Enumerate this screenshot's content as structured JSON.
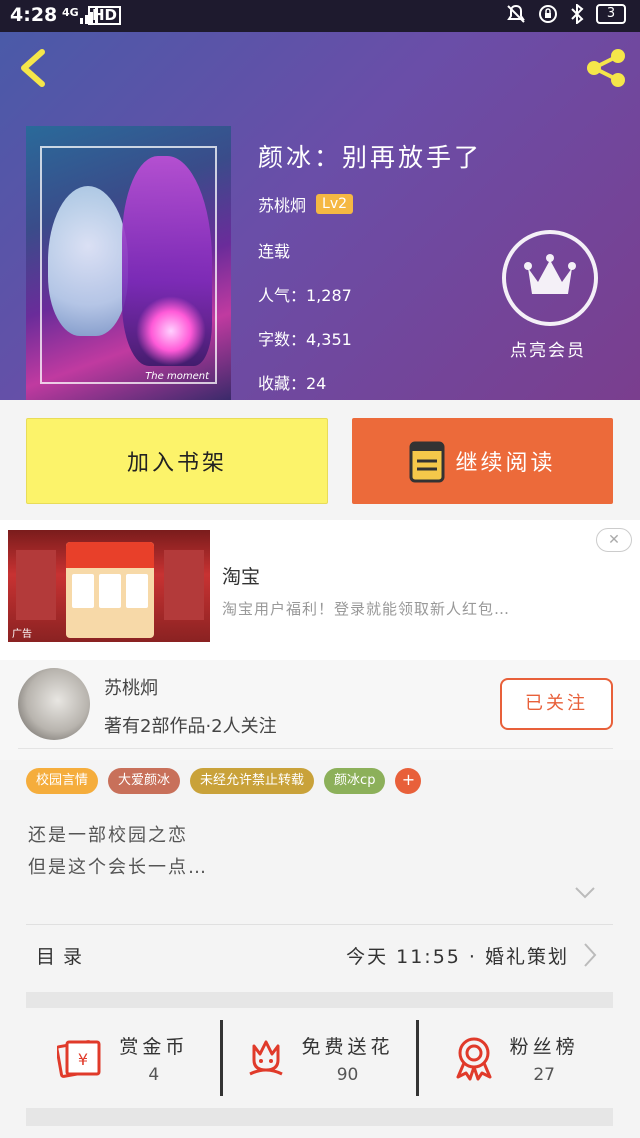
{
  "status_bar": {
    "time": "4:28",
    "network": "4G",
    "hd": "HD",
    "battery": "3"
  },
  "book": {
    "title": "颜冰：别再放手了",
    "author": "苏桃炯",
    "level": "Lv2",
    "status": "连载",
    "popularity": "人气：1,287",
    "word_count": "字数：4,351",
    "favorites": "收藏：24",
    "cover_signature": "The moment"
  },
  "vip": {
    "label": "点亮会员"
  },
  "buttons": {
    "add_to_shelf": "加入书架",
    "continue_reading": "继续阅读"
  },
  "ad": {
    "title": "淘宝",
    "description": "淘宝用户福利！登录就能领取新人红包…",
    "tag": "广告",
    "close": "✕"
  },
  "author_section": {
    "name": "苏桃炯",
    "works": "著有2部作品·2人关注",
    "follow_label": "已关注"
  },
  "tags": [
    {
      "label": "校园言情",
      "color": "#f5ad3c"
    },
    {
      "label": "大爱颜冰",
      "color": "#c8705a"
    },
    {
      "label": "未经允许禁止转载",
      "color": "#c9a23a"
    },
    {
      "label": "颜冰cp",
      "color": "#8cb05a"
    }
  ],
  "tag_add": "+",
  "description": {
    "line1": "还是一部校园之恋",
    "line2": "但是这个会长一点…"
  },
  "toc": {
    "label": "目录",
    "latest": "今天 11:55 · 婚礼策划"
  },
  "actions": [
    {
      "label": "赏金币",
      "value": "4",
      "icon": "coin-envelope-icon"
    },
    {
      "label": "免费送花",
      "value": "90",
      "icon": "flower-icon"
    },
    {
      "label": "粉丝榜",
      "value": "27",
      "icon": "award-icon"
    }
  ],
  "colors": {
    "accent": "#e8603a",
    "shelf_button": "#fcf36a",
    "read_button": "#ec6a3a",
    "level_badge": "#f5b843"
  }
}
